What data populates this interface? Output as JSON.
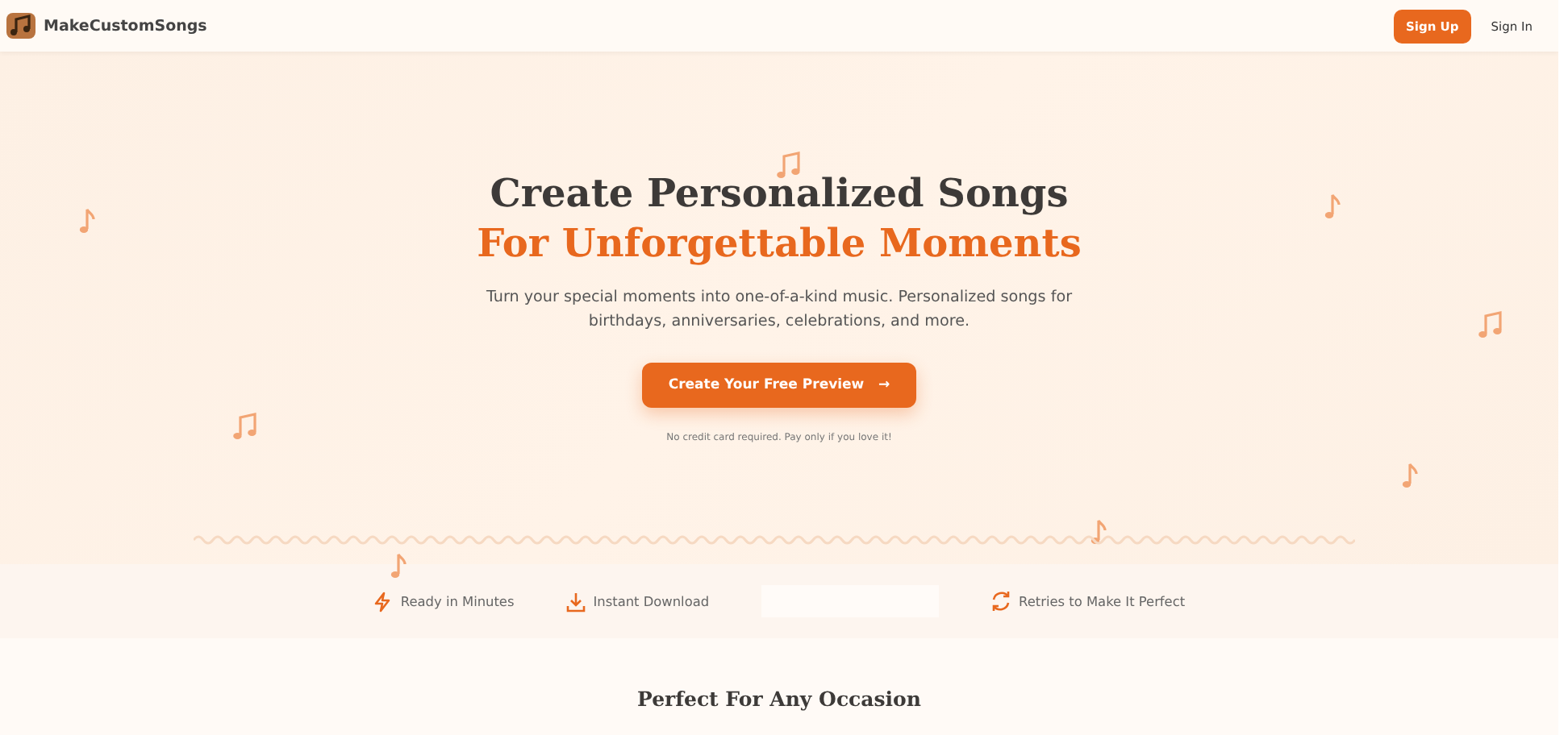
{
  "header": {
    "brand": "MakeCustomSongs",
    "buttons": [
      {
        "label": "Sign Up",
        "kind": "primary"
      },
      {
        "label": "Sign In",
        "kind": "plain"
      }
    ]
  },
  "hero": {
    "title": "Create Personalized Songs",
    "title_accent": "For Unforgettable Moments",
    "subtitle": "Turn your special moments into one-of-a-kind music. Personalized songs for birthdays, anniversaries, celebrations, and more.",
    "cta": "Create Your Free Preview",
    "cta_icon": "→",
    "note": "No credit card required. Pay only if you love it!"
  },
  "features": [
    {
      "kind": "bolt",
      "label": "Ready in Minutes"
    },
    {
      "kind": "download",
      "label": "Instant Download"
    },
    {
      "kind": "empty"
    },
    {
      "kind": "refresh",
      "label": "Retries to Make It Perfect"
    }
  ],
  "section": {
    "heading": "Perfect For Any Occasion"
  }
}
